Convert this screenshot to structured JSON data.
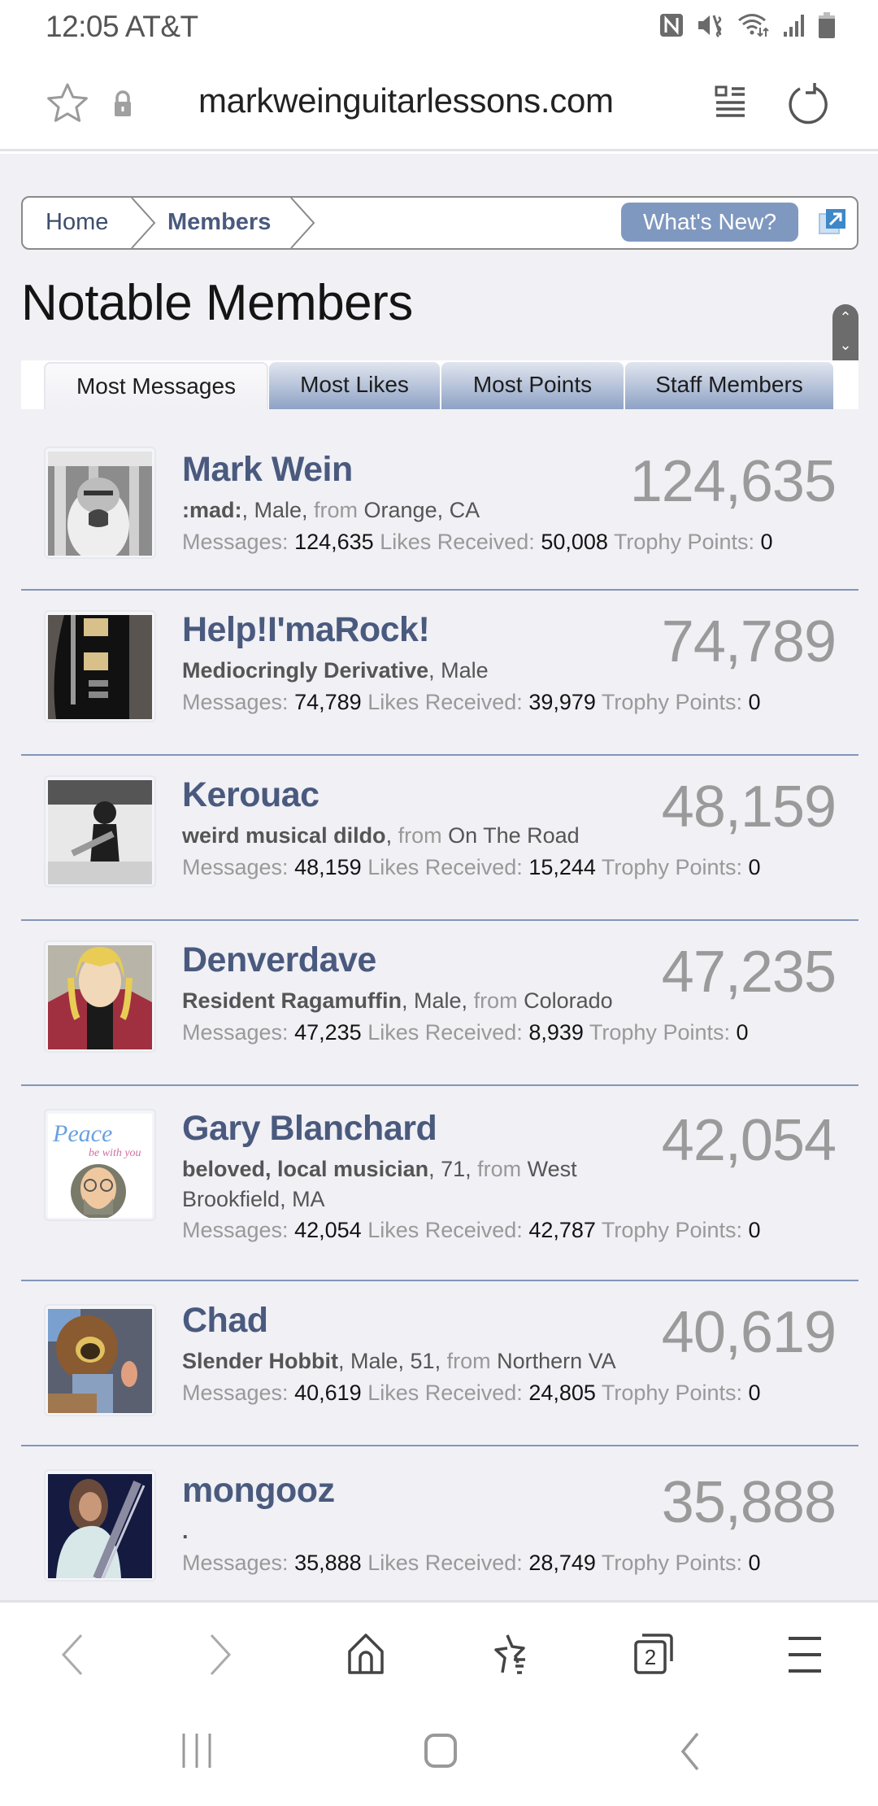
{
  "status_bar": {
    "time": "12:05",
    "carrier": "AT&T",
    "time_carrier": "12:05 AT&T",
    "icons": [
      "nfc-icon",
      "vibrate-icon",
      "wifi-icon",
      "signal-icon",
      "battery-icon"
    ]
  },
  "browser": {
    "url": "markweinguitarlessons.com",
    "icons": [
      "star-icon",
      "lock-icon",
      "reader-mode-icon",
      "refresh-icon"
    ],
    "toolbar_icons": [
      "back-icon",
      "forward-icon",
      "home-icon",
      "bookmarks-icon",
      "tabs-icon",
      "menu-icon"
    ],
    "tab_count": "2"
  },
  "breadcrumb": {
    "items": [
      "Home",
      "Members"
    ],
    "whats_new": "What's New?"
  },
  "page": {
    "title": "Notable Members"
  },
  "tabs": [
    {
      "label": "Most Messages",
      "active": true
    },
    {
      "label": "Most Likes",
      "active": false
    },
    {
      "label": "Most Points",
      "active": false
    },
    {
      "label": "Staff Members",
      "active": false
    }
  ],
  "stat_labels": {
    "messages": "Messages:",
    "likes": "Likes Received:",
    "trophy": "Trophy Points:"
  },
  "members": [
    {
      "name": "Mark Wein",
      "count": "124,635",
      "title": ":mad:",
      "details": ", Male, ",
      "from_label": "from",
      "location": " Orange, CA",
      "messages": "124,635",
      "likes": "50,008",
      "trophy": "0"
    },
    {
      "name": "Help!I'maRock!",
      "count": "74,789",
      "title": "Mediocringly Derivative",
      "details": ", Male",
      "from_label": "",
      "location": "",
      "messages": "74,789",
      "likes": "39,979",
      "trophy": "0"
    },
    {
      "name": "Kerouac",
      "count": "48,159",
      "title": "weird musical dildo",
      "details": ", ",
      "from_label": "from",
      "location": " On The Road",
      "messages": "48,159",
      "likes": "15,244",
      "trophy": "0"
    },
    {
      "name": "Denverdave",
      "count": "47,235",
      "title": "Resident Ragamuffin",
      "details": ", Male, ",
      "from_label": "from",
      "location": " Colorado",
      "messages": "47,235",
      "likes": "8,939",
      "trophy": "0"
    },
    {
      "name": "Gary Blanchard",
      "count": "42,054",
      "title": "beloved, local musician",
      "details": ", 71, ",
      "from_label": "from",
      "location": " West Brookfield, MA",
      "messages": "42,054",
      "likes": "42,787",
      "trophy": "0"
    },
    {
      "name": "Chad",
      "count": "40,619",
      "title": "Slender Hobbit",
      "details": ", Male, 51, ",
      "from_label": "from",
      "location": " Northern VA",
      "messages": "40,619",
      "likes": "24,805",
      "trophy": "0"
    },
    {
      "name": "mongooz",
      "count": "35,888",
      "title": ".",
      "details": "",
      "from_label": "",
      "location": "",
      "messages": "35,888",
      "likes": "28,749",
      "trophy": "0"
    }
  ],
  "colors": {
    "accent": "#4a5a7e",
    "button": "#7f98c0",
    "page_bg": "#f0f0f5",
    "divider": "#8495b8"
  }
}
